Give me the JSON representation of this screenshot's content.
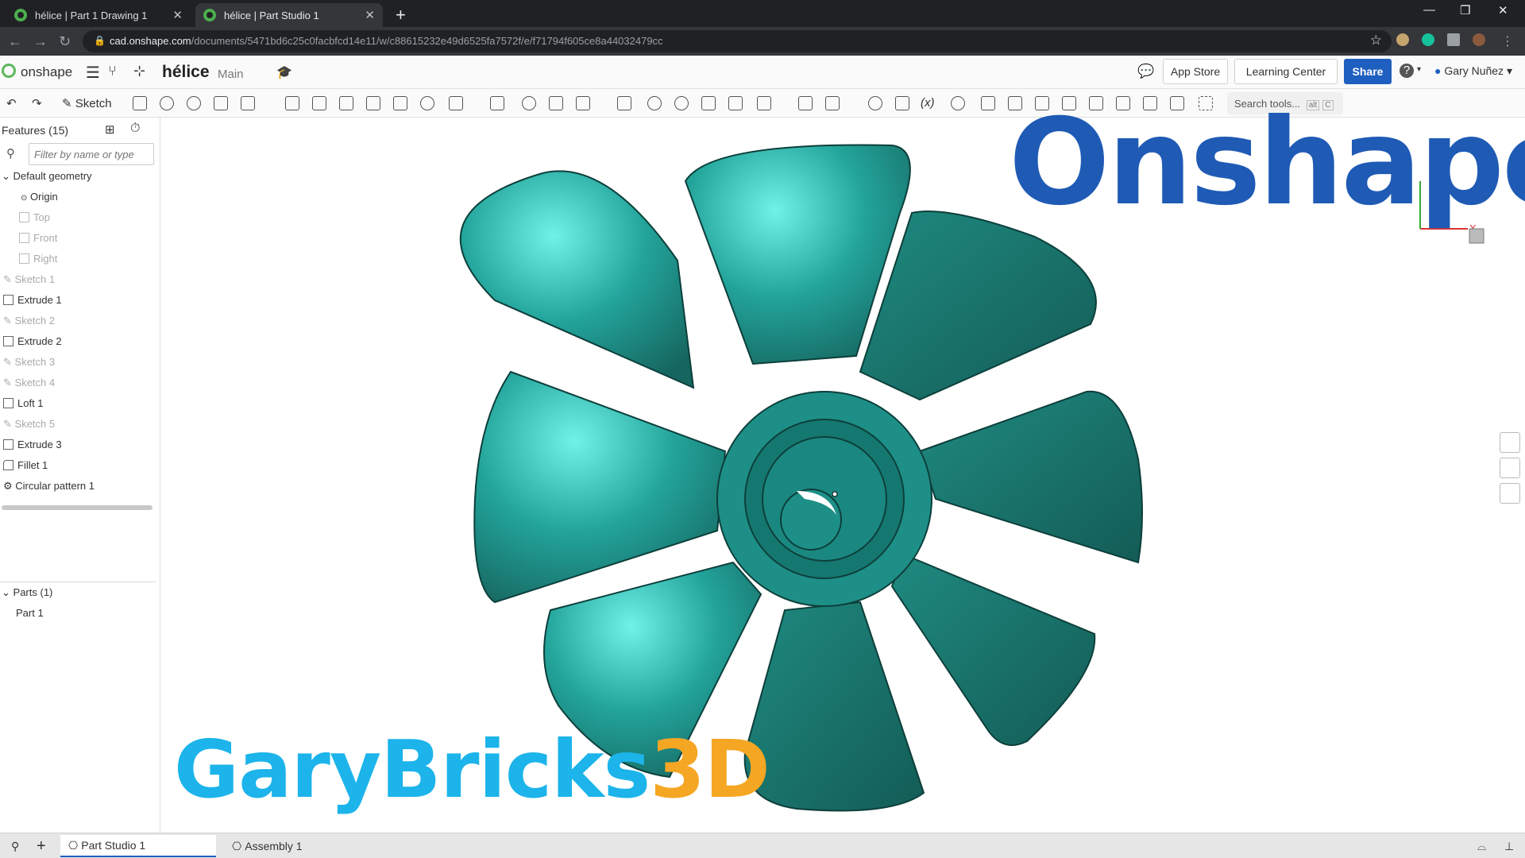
{
  "browser": {
    "tabs": [
      {
        "title": "hélice | Part 1 Drawing 1",
        "active": false
      },
      {
        "title": "hélice | Part Studio 1",
        "active": true
      }
    ],
    "url_host": "cad.onshape.com",
    "url_path": "/documents/5471bd6c25c0facbfcd14e11/w/c88615232e49d6525fa7572f/e/f71794f605ce8a44032479cc",
    "new_tab": "+",
    "win_min": "—",
    "win_restore": "❐",
    "win_close": "✕"
  },
  "appbar": {
    "logo": "onshape",
    "doc_title": "hélice",
    "branch": "Main",
    "app_store": "App Store",
    "learning_center": "Learning Center",
    "share": "Share",
    "help": "?",
    "user": "Gary Nuñez"
  },
  "toolbar": {
    "sketch_label": "Sketch",
    "search_placeholder": "Search tools...",
    "search_kbd_alt": "alt",
    "search_kbd_c": "C"
  },
  "features": {
    "header": "Features (15)",
    "filter_placeholder": "Filter by name or type",
    "default_geometry": "Default geometry",
    "items": [
      {
        "label": "Origin",
        "muted": false
      },
      {
        "label": "Top",
        "muted": true
      },
      {
        "label": "Front",
        "muted": true
      },
      {
        "label": "Right",
        "muted": true
      },
      {
        "label": "Sketch 1",
        "muted": true
      },
      {
        "label": "Extrude 1",
        "muted": false
      },
      {
        "label": "Sketch 2",
        "muted": true
      },
      {
        "label": "Extrude 2",
        "muted": false
      },
      {
        "label": "Sketch 3",
        "muted": true
      },
      {
        "label": "Sketch 4",
        "muted": true
      },
      {
        "label": "Loft 1",
        "muted": false
      },
      {
        "label": "Sketch 5",
        "muted": true
      },
      {
        "label": "Extrude 3",
        "muted": false
      },
      {
        "label": "Fillet 1",
        "muted": false
      },
      {
        "label": "Circular pattern 1",
        "muted": false
      }
    ],
    "parts_header": "Parts (1)",
    "parts": [
      "Part 1"
    ]
  },
  "viewport": {
    "brand_overlay": "Onshape",
    "watermark_main": "GaryBricks",
    "watermark_3d": "3D",
    "triad_axis_x": "X",
    "part_color": "#1d8f87"
  },
  "bottom_tabs": [
    {
      "label": "Part Studio 1",
      "active": true
    },
    {
      "label": "Assembly 1",
      "active": false
    }
  ],
  "colors": {
    "accent": "#1f5fbf",
    "brand": "#1f5bb5",
    "watermark": "#1cb4ea",
    "watermark_accent": "#f5a623"
  }
}
